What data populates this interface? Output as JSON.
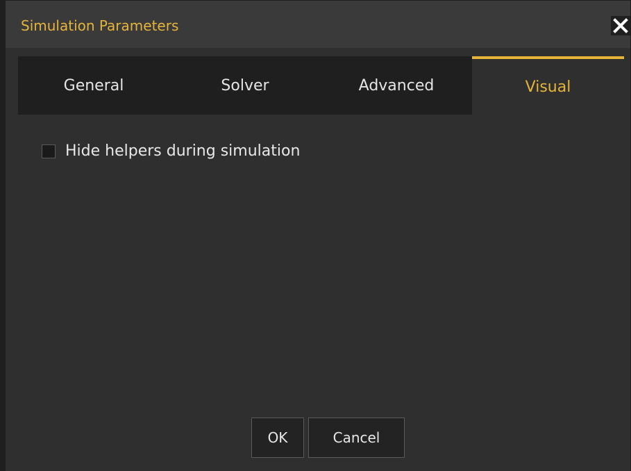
{
  "dialog": {
    "title": "Simulation Parameters",
    "close_icon": "close-icon"
  },
  "tabs": [
    {
      "label": "General",
      "active": false
    },
    {
      "label": "Solver",
      "active": false
    },
    {
      "label": "Advanced",
      "active": false
    },
    {
      "label": "Visual",
      "active": true
    }
  ],
  "visual": {
    "hide_helpers_label": "Hide helpers during simulation",
    "hide_helpers_checked": false
  },
  "buttons": {
    "ok": "OK",
    "cancel": "Cancel"
  },
  "colors": {
    "accent": "#e6b43a",
    "background": "#2f2f2f",
    "tabbar": "#1f1f1f"
  }
}
